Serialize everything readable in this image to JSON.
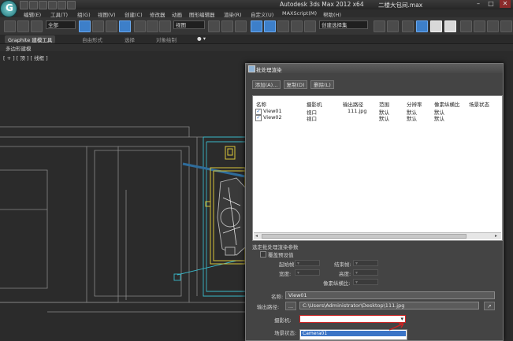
{
  "titlebar": {
    "app_title": "Autodesk 3ds Max  2012 x64",
    "file_name": "二楼大包间.max",
    "minimize": "–",
    "maximize": "□",
    "close": "✕"
  },
  "menu": [
    "编辑(E)",
    "工具(T)",
    "组(G)",
    "视图(V)",
    "创建(C)",
    "修改器",
    "动画",
    "图形编辑器",
    "渲染(R)",
    "自定义(U)",
    "MAXScript(M)",
    "帮助(H)"
  ],
  "toolbar": {
    "selection_filter": "全部",
    "ref_coord": "视图",
    "named_selection": "创建选择集"
  },
  "ribbon": {
    "tabs": [
      "Graphite 建模工具",
      "自由形式",
      "选择",
      "对象绘制"
    ],
    "sub_label": "多边形建模"
  },
  "viewport": {
    "label": "[ + ] [ 顶 ] [ 线框 ]"
  },
  "dialog": {
    "title": "批处理渲染",
    "buttons": {
      "add": "添加(A)...",
      "copy": "复制(D)",
      "delete": "删除(L)"
    },
    "columns": [
      "名称",
      "摄影机",
      "输出路径",
      "范围",
      "分辨率",
      "像素纵横比",
      "场景状态"
    ],
    "rows": [
      {
        "name": "View01",
        "camera": "视口",
        "output": "111.jpg",
        "range": "默认",
        "resolution": "默认",
        "aspect": "默认"
      },
      {
        "name": "View02",
        "camera": "视口",
        "output": "",
        "range": "默认",
        "resolution": "默认",
        "aspect": "默认"
      }
    ],
    "params_header": "选定批处理渲染参数",
    "override_label": "覆盖预设值",
    "start_frame_label": "起始帧:",
    "end_frame_label": "结束帧:",
    "width_label": "宽度:",
    "height_label": "高度:",
    "pixel_aspect_label": "像素纵横比:",
    "name_label": "名称:",
    "name_value": "View01",
    "output_label": "输出路径:",
    "output_browse": "...",
    "output_value": "C:\\Users\\Administrator\\Desktop\\111.jpg",
    "camera_label": "摄影机:",
    "scene_state_label": "场景状态:",
    "dropdown_option": "Camera01"
  },
  "colors": {
    "viewport_bg": "#2b2b2b",
    "selection_blue": "#3b74c6",
    "highlight_red": "#cc2222",
    "scene_yellow": "#d8c63a",
    "scene_cyan": "#39b8c9"
  }
}
